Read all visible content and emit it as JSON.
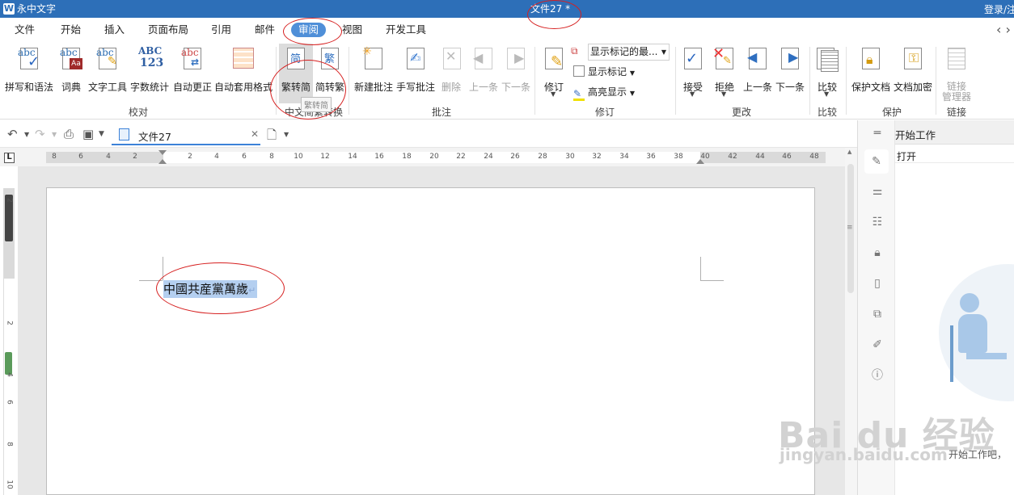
{
  "app": {
    "name": "永中文字",
    "logo": "W",
    "doc_title": "文件27 *",
    "login": "登录/注"
  },
  "menu": {
    "items": [
      "文件",
      "开始",
      "插入",
      "页面布局",
      "引用",
      "邮件",
      "审阅",
      "视图",
      "开发工具"
    ],
    "active": "审阅"
  },
  "ribbon": {
    "proofing": {
      "label": "校对",
      "buttons": [
        "拼写和语法",
        "词典",
        "文字工具",
        "字数统计",
        "自动更正",
        "自动套用格式"
      ]
    },
    "chinese": {
      "label": "中文简繁转换",
      "buttons": [
        "繁转简",
        "简转繁"
      ],
      "tooltip": "繁转简",
      "glyph_simplified": "简",
      "glyph_traditional": "繁"
    },
    "comments": {
      "label": "批注",
      "buttons": [
        "新建批注",
        "手写批注",
        "删除",
        "上一条",
        "下一条"
      ]
    },
    "tracking": {
      "label": "修订",
      "track_button": "修订",
      "markup_combo": "显示标记的最...",
      "show_markup": "显示标记",
      "highlight": "高亮显示"
    },
    "changes": {
      "label": "更改",
      "buttons": [
        "接受",
        "拒绝",
        "上一条",
        "下一条"
      ]
    },
    "compare": {
      "label": "比较",
      "buttons": [
        "比较"
      ]
    },
    "protect": {
      "label": "保护",
      "buttons": [
        "保护文档",
        "文档加密"
      ]
    },
    "link": {
      "label": "链接",
      "button_line1": "链接",
      "button_line2": "管理器"
    }
  },
  "doc_tab": {
    "name": "文件27"
  },
  "ruler": {
    "h_numbers": [
      "8",
      "6",
      "4",
      "2",
      "2",
      "4",
      "6",
      "8",
      "10",
      "12",
      "14",
      "16",
      "18",
      "20",
      "22",
      "24",
      "26",
      "28",
      "30",
      "32",
      "34",
      "36",
      "38",
      "40",
      "42",
      "44",
      "46",
      "48"
    ],
    "v_numbers": [
      "2",
      "2",
      "4",
      "6",
      "8",
      "10"
    ]
  },
  "document": {
    "selected_text": "中國共産黨萬歲",
    "paragraph_mark": "↵"
  },
  "sidebar": {
    "title": "开始工作",
    "open": "打开",
    "caption": "开始工作吧，"
  },
  "watermark": {
    "main": "Bai du 经验",
    "sub": "jingyan.baidu.com"
  },
  "colors": {
    "accent": "#2d6fb8",
    "active_tab": "#4f8fd8",
    "selection": "#b4cff0",
    "annotation": "#d62020"
  }
}
